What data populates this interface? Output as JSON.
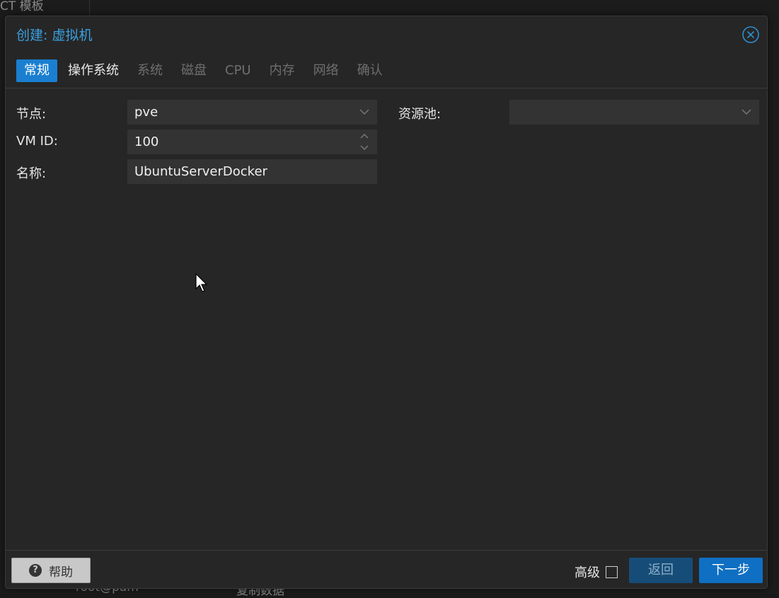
{
  "background": {
    "top_left_text": "CT 模板",
    "bottom_left_text": "root@pam",
    "bottom_mid_text": "复制数据"
  },
  "dialog": {
    "title": "创建: 虚拟机",
    "tabs": [
      {
        "label": "常规",
        "state": "active"
      },
      {
        "label": "操作系统",
        "state": "enabled"
      },
      {
        "label": "系统",
        "state": "disabled"
      },
      {
        "label": "磁盘",
        "state": "disabled"
      },
      {
        "label": "CPU",
        "state": "disabled"
      },
      {
        "label": "内存",
        "state": "disabled"
      },
      {
        "label": "网络",
        "state": "disabled"
      },
      {
        "label": "确认",
        "state": "disabled"
      }
    ],
    "form": {
      "node_label": "节点:",
      "node_value": "pve",
      "vmid_label": "VM ID:",
      "vmid_value": "100",
      "name_label": "名称:",
      "name_value": "UbuntuServerDocker",
      "pool_label": "资源池:",
      "pool_value": ""
    },
    "footer": {
      "help_label": "帮助",
      "advanced_label": "高级",
      "advanced_checked": false,
      "back_label": "返回",
      "next_label": "下一步"
    }
  },
  "colors": {
    "accent": "#1a7fd0",
    "title": "#3aa0e0",
    "dialog_bg": "#262626",
    "field_bg": "#333333"
  },
  "icons": {
    "close": "close-circle-icon",
    "dropdown": "chevron-down-icon",
    "spinner": "spinner-arrows-icon",
    "help": "question-circle-icon",
    "cursor": "mouse-pointer-icon"
  }
}
